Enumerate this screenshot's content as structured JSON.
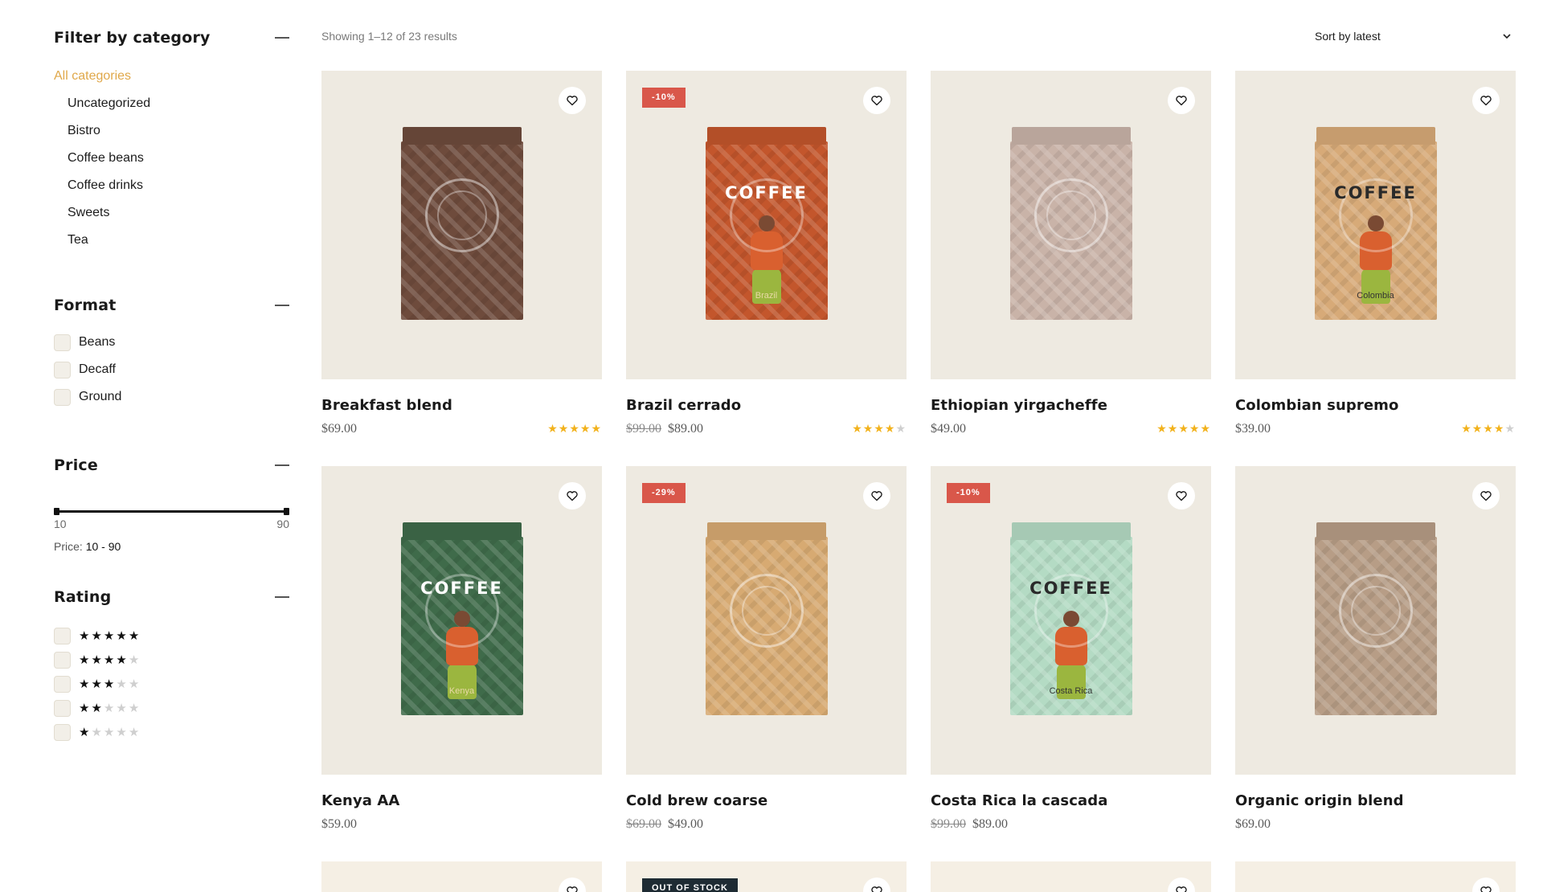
{
  "sidebar": {
    "category": {
      "title": "Filter by category",
      "items": [
        "All categories",
        "Uncategorized",
        "Bistro",
        "Coffee beans",
        "Coffee drinks",
        "Sweets",
        "Tea"
      ]
    },
    "format": {
      "title": "Format",
      "items": [
        "Beans",
        "Decaff",
        "Ground"
      ]
    },
    "price": {
      "title": "Price",
      "min_label": "10",
      "max_label": "90",
      "readout_prefix": "Price:",
      "readout_value": "10 - 90"
    },
    "rating": {
      "title": "Rating",
      "levels": [
        5,
        4,
        3,
        2,
        1
      ]
    }
  },
  "toolbar": {
    "results": "Showing 1–12 of 23 results",
    "sort_label": "Sort by latest"
  },
  "colors": {
    "accent": "#e0a84a",
    "sale_badge": "#d9574a",
    "stock_badge": "#1e2b33",
    "star": "#f2b21c",
    "card_bg": "#eeeae1"
  },
  "products": [
    {
      "name": "Breakfast blend",
      "price": "$69.00",
      "old_price": "",
      "badge": "",
      "rating": 5,
      "bag": "#6e4b3c",
      "word": "",
      "origin": "",
      "figure": false
    },
    {
      "name": "Brazil cerrado",
      "price": "$89.00",
      "old_price": "$99.00",
      "badge": "-10%",
      "rating": 4,
      "bag": "#c3562c",
      "word": "COFFEE",
      "origin": "Brazil",
      "figure": true
    },
    {
      "name": "Ethiopian yirgacheffe",
      "price": "$49.00",
      "old_price": "",
      "badge": "",
      "rating": 5,
      "bag": "#c9b3a8",
      "word": "",
      "origin": "",
      "figure": false
    },
    {
      "name": "Colombian supremo",
      "price": "$39.00",
      "old_price": "",
      "badge": "",
      "rating": 4,
      "bag": "#d7aa78",
      "word": "COFFEE",
      "origin": "Colombia",
      "figure": true
    },
    {
      "name": "Kenya AA",
      "price": "$59.00",
      "old_price": "",
      "badge": "",
      "rating": 0,
      "bag": "#3f6b4a",
      "word": "COFFEE",
      "origin": "Kenya",
      "figure": true
    },
    {
      "name": "Cold brew coarse",
      "price": "$49.00",
      "old_price": "$69.00",
      "badge": "-29%",
      "rating": 0,
      "bag": "#d7aa72",
      "word": "",
      "origin": "",
      "figure": false
    },
    {
      "name": "Costa Rica la cascada",
      "price": "$89.00",
      "old_price": "$99.00",
      "badge": "-10%",
      "rating": 0,
      "bag": "#b4dbc4",
      "word": "COFFEE",
      "origin": "Costa Rica",
      "figure": true
    },
    {
      "name": "Organic origin blend",
      "price": "$69.00",
      "old_price": "",
      "badge": "",
      "rating": 0,
      "bag": "#b79d86",
      "word": "",
      "origin": "",
      "figure": false
    }
  ],
  "peek_row": [
    {
      "badge": ""
    },
    {
      "badge": "OUT OF STOCK"
    },
    {
      "badge": ""
    },
    {
      "badge": ""
    }
  ]
}
